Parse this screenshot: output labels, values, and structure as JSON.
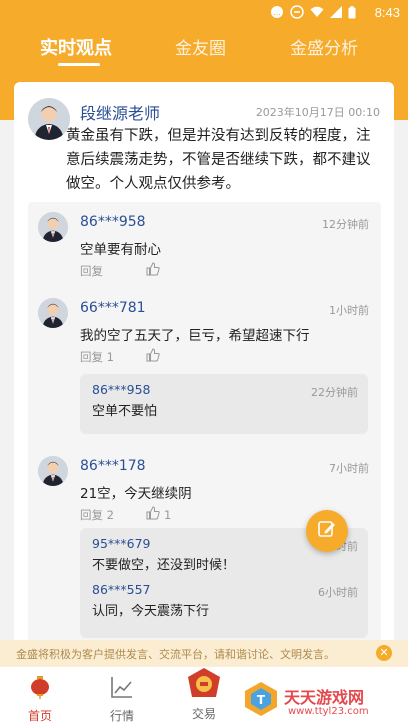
{
  "status_bar": {
    "time": "8:43"
  },
  "tabs": [
    {
      "label": "实时观点",
      "active": true
    },
    {
      "label": "金友圈",
      "active": false
    },
    {
      "label": "金盛分析",
      "active": false
    }
  ],
  "post": {
    "author": "段继源老师",
    "time": "2023年10月17日 00:10",
    "body": "黄金虽有下跌，但是并没有达到反转的程度，注意后续震荡走势，不管是否继续下跌，都不建议做空。个人观点仅供参考。"
  },
  "comments": [
    {
      "user": "86***958",
      "time": "12分钟前",
      "text": "空单要有耐心",
      "reply_label": "回复",
      "likes": "",
      "replies": []
    },
    {
      "user": "66***781",
      "time": "1小时前",
      "text": "我的空了五天了，巨亏，希望超速下行",
      "reply_label": "回复 1",
      "likes": "",
      "replies": [
        {
          "user": "86***958",
          "time": "22分钟前",
          "text": "空单不要怕"
        }
      ]
    },
    {
      "user": "86***178",
      "time": "7小时前",
      "text": "21空，今天继续阴",
      "reply_label": "回复 2",
      "likes": "1",
      "replies": [
        {
          "user": "95***679",
          "time": "5小时前",
          "text": "不要做空，还没到时候！"
        },
        {
          "user": "86***557",
          "time": "6小时前",
          "text": "认同，今天震荡下行"
        }
      ]
    }
  ],
  "notice": {
    "text": "金盛将积极为客户提供发言、交流平台，请和谐讨论、文明发言。"
  },
  "bottom_nav": [
    {
      "label": "首页",
      "icon": "lantern-icon",
      "active": true
    },
    {
      "label": "行情",
      "icon": "chart-icon",
      "active": false
    },
    {
      "label": "交易",
      "icon": "trade-icon",
      "active": false
    }
  ],
  "watermark": {
    "title": "天天游戏网",
    "url": "www.ttyl23.com"
  },
  "colors": {
    "brand": "#f6ab2b",
    "link": "#2a4f93",
    "notice_bg": "#fbedd2"
  }
}
